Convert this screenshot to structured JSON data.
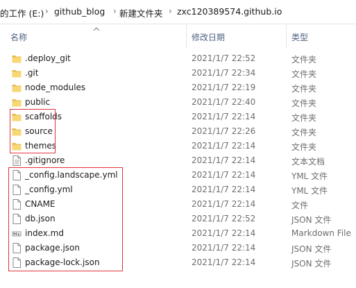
{
  "breadcrumb": {
    "segments": [
      "的工作 (E:)",
      "github_blog",
      "新建文件夹",
      "zxc120389574.github.io"
    ],
    "separator": "›"
  },
  "columns": {
    "name": "名称",
    "date": "修改日期",
    "type": "类型"
  },
  "files": [
    {
      "name": ".deploy_git",
      "date": "2021/1/7 22:52",
      "type": "文件夹",
      "icon": "folder-icon"
    },
    {
      "name": ".git",
      "date": "2021/1/7 22:34",
      "type": "文件夹",
      "icon": "folder-icon"
    },
    {
      "name": "node_modules",
      "date": "2021/1/7 22:19",
      "type": "文件夹",
      "icon": "folder-icon"
    },
    {
      "name": "public",
      "date": "2021/1/7 22:40",
      "type": "文件夹",
      "icon": "folder-icon"
    },
    {
      "name": "scaffolds",
      "date": "2021/1/7 22:14",
      "type": "文件夹",
      "icon": "folder-icon"
    },
    {
      "name": "source",
      "date": "2021/1/7 22:26",
      "type": "文件夹",
      "icon": "folder-icon"
    },
    {
      "name": "themes",
      "date": "2021/1/7 22:14",
      "type": "文件夹",
      "icon": "folder-icon"
    },
    {
      "name": ".gitignore",
      "date": "2021/1/7 22:14",
      "type": "文本文档",
      "icon": "text-file-icon"
    },
    {
      "name": "_config.landscape.yml",
      "date": "2021/1/7 22:14",
      "type": "YML 文件",
      "icon": "file-icon"
    },
    {
      "name": "_config.yml",
      "date": "2021/1/7 22:14",
      "type": "YML 文件",
      "icon": "file-icon"
    },
    {
      "name": "CNAME",
      "date": "2021/1/7 22:14",
      "type": "文件",
      "icon": "file-icon"
    },
    {
      "name": "db.json",
      "date": "2021/1/7 22:52",
      "type": "JSON 文件",
      "icon": "file-icon"
    },
    {
      "name": "index.md",
      "date": "2021/1/7 22:14",
      "type": "Markdown File",
      "icon": "markdown-file-icon"
    },
    {
      "name": "package.json",
      "date": "2021/1/7 22:14",
      "type": "JSON 文件",
      "icon": "file-icon"
    },
    {
      "name": "package-lock.json",
      "date": "2021/1/7 22:14",
      "type": "JSON 文件",
      "icon": "file-icon"
    }
  ],
  "colors": {
    "folder": "#f8d775",
    "folder_dark": "#e5b84d",
    "highlight": "#e0313b",
    "header_text": "#4d6082"
  }
}
